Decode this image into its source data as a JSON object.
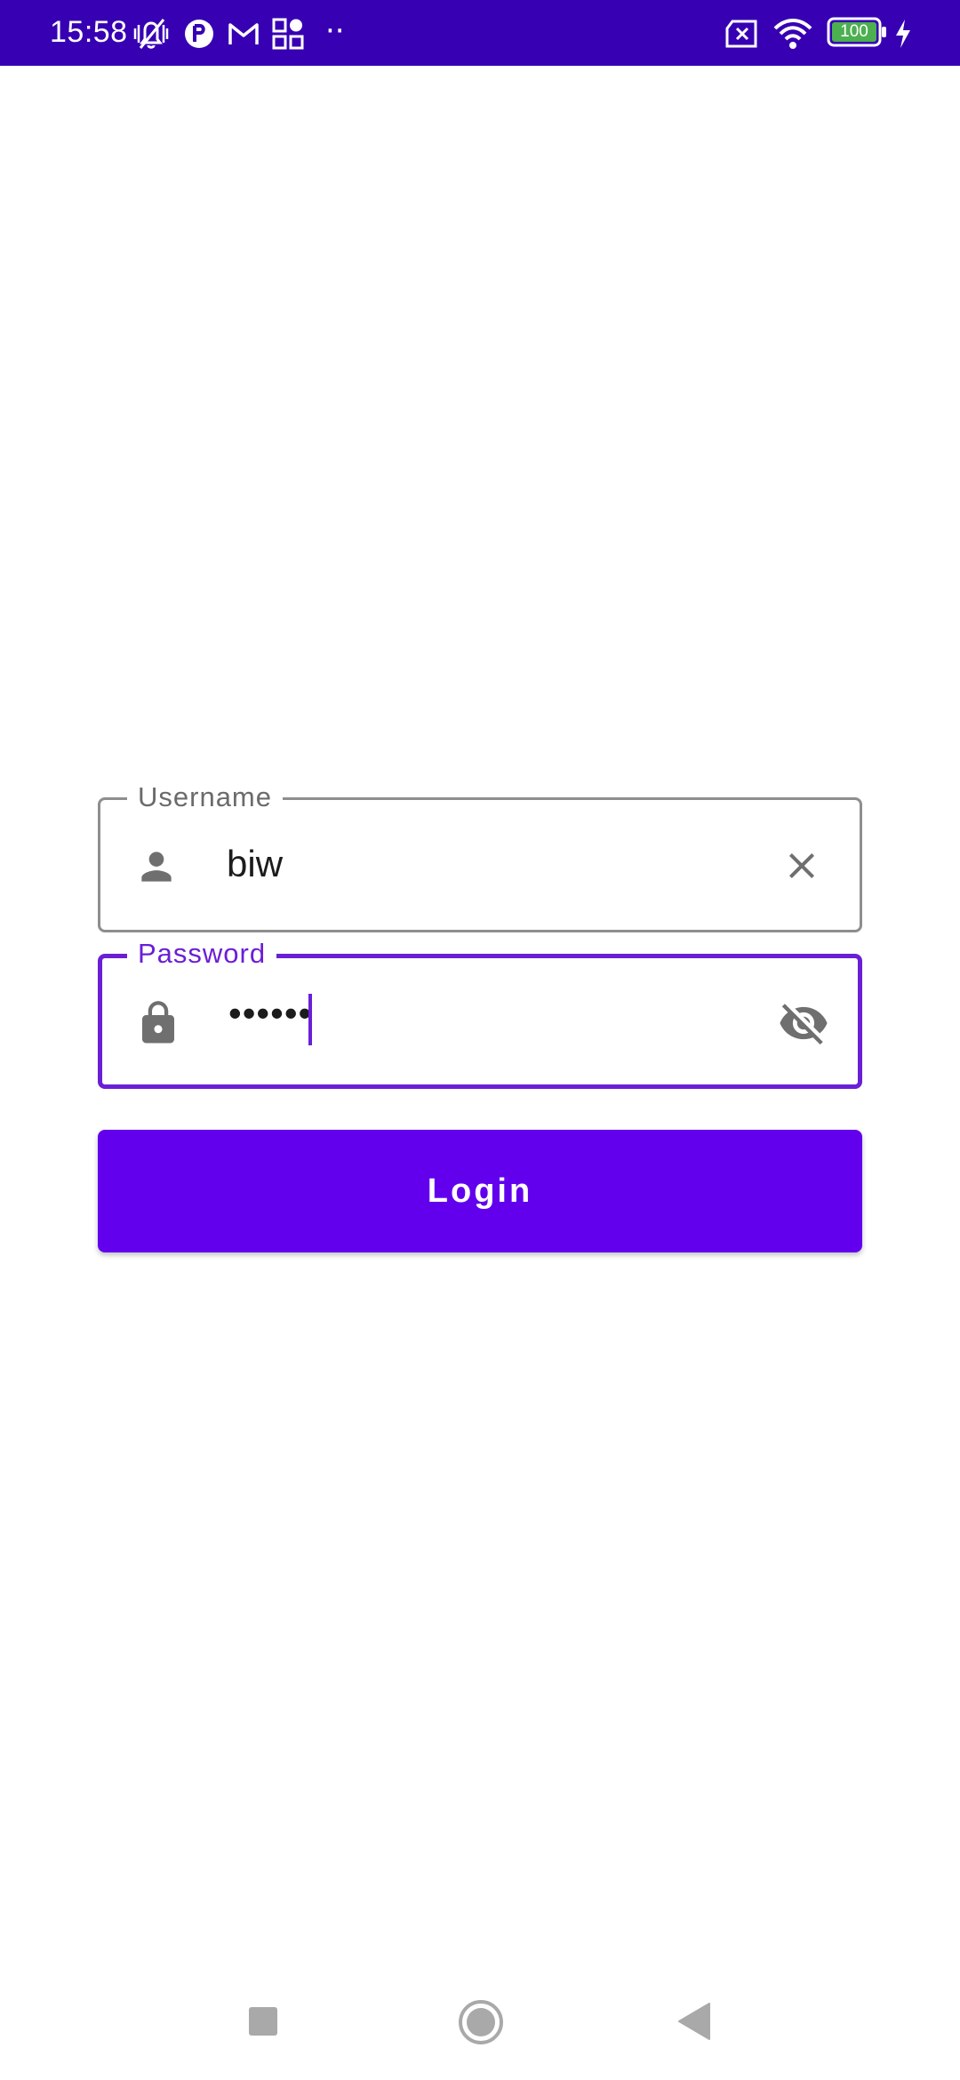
{
  "status_bar": {
    "time": "15:58",
    "dots": "··",
    "battery_level": "100",
    "icons": [
      "vibrate-off-icon",
      "app-notification-icon",
      "gmail-icon",
      "apps-icon",
      "sim-error-icon",
      "wifi-icon",
      "battery-icon",
      "charging-icon"
    ],
    "background_color": "#3700b3"
  },
  "login_form": {
    "username": {
      "label": "Username",
      "value": "biw",
      "leading_icon": "person-icon",
      "trailing_icon": "clear-icon"
    },
    "password": {
      "label": "Password",
      "value": "••••••",
      "leading_icon": "lock-icon",
      "trailing_icon": "visibility-off-icon",
      "focused": true
    },
    "login_button": {
      "label": "Login",
      "color": "#6200ee"
    }
  },
  "nav_bar": {
    "items": [
      "recents-button",
      "home-button",
      "back-button"
    ]
  },
  "colors": {
    "accent": "#6a1fd6",
    "primary": "#6200ee"
  }
}
